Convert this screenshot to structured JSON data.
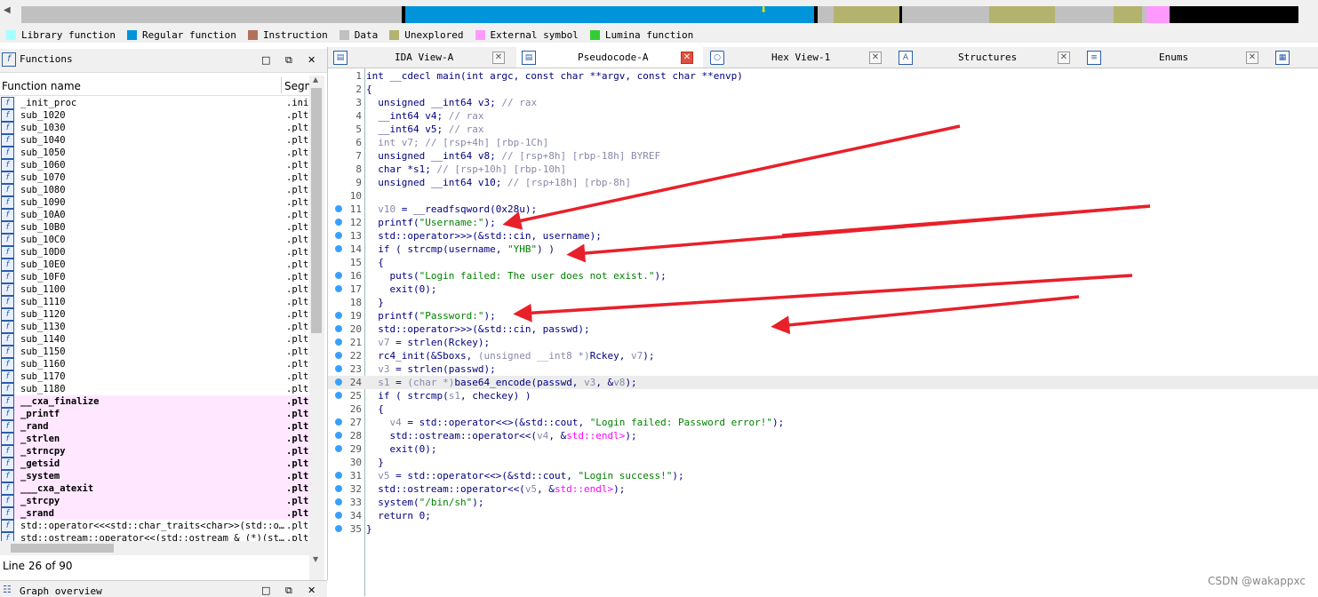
{
  "navbar": {
    "segments": [
      {
        "color": "#c0c0c0",
        "w": 428
      },
      {
        "color": "#000000",
        "w": 4
      },
      {
        "color": "#0094da",
        "w": 460
      },
      {
        "color": "#000000",
        "w": 4
      },
      {
        "color": "#c0c0c0",
        "w": 18
      },
      {
        "color": "#b3b36e",
        "w": 74
      },
      {
        "color": "#000000",
        "w": 3
      },
      {
        "color": "#c0c0c0",
        "w": 98
      },
      {
        "color": "#b3b36e",
        "w": 74
      },
      {
        "color": "#c0c0c0",
        "w": 66
      },
      {
        "color": "#b3b36e",
        "w": 32
      },
      {
        "color": "#c0c0c0",
        "w": 5
      },
      {
        "color": "#ff99ff",
        "w": 26
      },
      {
        "color": "#000000",
        "w": 145
      }
    ]
  },
  "legend": [
    {
      "label": "Library function",
      "color": "#a6ffff"
    },
    {
      "label": "Regular function",
      "color": "#0094da"
    },
    {
      "label": "Instruction",
      "color": "#b3705a"
    },
    {
      "label": "Data",
      "color": "#c0c0c0"
    },
    {
      "label": "Unexplored",
      "color": "#b3b36e"
    },
    {
      "label": "External symbol",
      "color": "#ff99ff"
    },
    {
      "label": "Lumina function",
      "color": "#33cc33"
    }
  ],
  "functions_panel": {
    "title": "Functions",
    "col_name": "Function name",
    "col_segment": "Segm",
    "status": "Line 26 of 90",
    "rows": [
      {
        "name": "_init_proc",
        "seg": ".init",
        "ext": false
      },
      {
        "name": "sub_1020",
        "seg": ".plt",
        "ext": false
      },
      {
        "name": "sub_1030",
        "seg": ".plt",
        "ext": false
      },
      {
        "name": "sub_1040",
        "seg": ".plt",
        "ext": false
      },
      {
        "name": "sub_1050",
        "seg": ".plt",
        "ext": false
      },
      {
        "name": "sub_1060",
        "seg": ".plt",
        "ext": false
      },
      {
        "name": "sub_1070",
        "seg": ".plt",
        "ext": false
      },
      {
        "name": "sub_1080",
        "seg": ".plt",
        "ext": false
      },
      {
        "name": "sub_1090",
        "seg": ".plt",
        "ext": false
      },
      {
        "name": "sub_10A0",
        "seg": ".plt",
        "ext": false
      },
      {
        "name": "sub_10B0",
        "seg": ".plt",
        "ext": false
      },
      {
        "name": "sub_10C0",
        "seg": ".plt",
        "ext": false
      },
      {
        "name": "sub_10D0",
        "seg": ".plt",
        "ext": false
      },
      {
        "name": "sub_10E0",
        "seg": ".plt",
        "ext": false
      },
      {
        "name": "sub_10F0",
        "seg": ".plt",
        "ext": false
      },
      {
        "name": "sub_1100",
        "seg": ".plt",
        "ext": false
      },
      {
        "name": "sub_1110",
        "seg": ".plt",
        "ext": false
      },
      {
        "name": "sub_1120",
        "seg": ".plt",
        "ext": false
      },
      {
        "name": "sub_1130",
        "seg": ".plt",
        "ext": false
      },
      {
        "name": "sub_1140",
        "seg": ".plt",
        "ext": false
      },
      {
        "name": "sub_1150",
        "seg": ".plt",
        "ext": false
      },
      {
        "name": "sub_1160",
        "seg": ".plt",
        "ext": false
      },
      {
        "name": "sub_1170",
        "seg": ".plt",
        "ext": false
      },
      {
        "name": "sub_1180",
        "seg": ".plt",
        "ext": false
      },
      {
        "name": "__cxa_finalize",
        "seg": ".plt",
        "ext": true
      },
      {
        "name": "_printf",
        "seg": ".plt",
        "ext": true
      },
      {
        "name": "_rand",
        "seg": ".plt",
        "ext": true
      },
      {
        "name": "_strlen",
        "seg": ".plt",
        "ext": true
      },
      {
        "name": "_strncpy",
        "seg": ".plt",
        "ext": true
      },
      {
        "name": "_getsid",
        "seg": ".plt",
        "ext": true
      },
      {
        "name": "_system",
        "seg": ".plt",
        "ext": true
      },
      {
        "name": "___cxa_atexit",
        "seg": ".plt",
        "ext": true
      },
      {
        "name": "_strcpy",
        "seg": ".plt",
        "ext": true
      },
      {
        "name": "_srand",
        "seg": ".plt",
        "ext": true
      },
      {
        "name": "std::operator<<<std::char_traits<char>>(std::o…",
        "seg": ".plt.",
        "ext": false
      },
      {
        "name": "std::ostream::operator<<(std::ostream & (*)(st…",
        "seg": ".plt.",
        "ext": false
      }
    ]
  },
  "graph_overview": {
    "title": "Graph overview"
  },
  "tabs": [
    {
      "label": "IDA View-A",
      "icon": "IDA",
      "active": false
    },
    {
      "label": "Pseudocode-A",
      "icon": "C",
      "active": true
    },
    {
      "label": "Hex View-1",
      "icon": "O",
      "active": false
    },
    {
      "label": "Structures",
      "icon": "A",
      "active": false
    },
    {
      "label": "Enums",
      "icon": "E",
      "active": false
    }
  ],
  "code_lines": [
    {
      "n": "1",
      "dot": false,
      "html": "int __cdecl main(int argc, const char **argv, const char **envp)"
    },
    {
      "n": "2",
      "dot": false,
      "html": "{"
    },
    {
      "n": "3",
      "dot": false,
      "html": "  unsigned __int64 v3; <span class=\"g\">// rax</span>"
    },
    {
      "n": "4",
      "dot": false,
      "html": "  __int64 v4; <span class=\"g\">// rax</span>"
    },
    {
      "n": "5",
      "dot": false,
      "html": "  __int64 v5; <span class=\"g\">// rax</span>"
    },
    {
      "n": "6",
      "dot": false,
      "html": "  <span class=\"g\">int v7; // [rsp+4h] [rbp-1Ch]</span>"
    },
    {
      "n": "7",
      "dot": false,
      "html": "  unsigned __int64 v8; <span class=\"g\">// [rsp+8h] [rbp-18h] BYREF</span>"
    },
    {
      "n": "8",
      "dot": false,
      "html": "  char *s1; <span class=\"g\">// [rsp+10h] [rbp-10h]</span>"
    },
    {
      "n": "9",
      "dot": false,
      "html": "  unsigned __int64 v10; <span class=\"g\">// [rsp+18h] [rbp-8h]</span>"
    },
    {
      "n": "10",
      "dot": false,
      "html": ""
    },
    {
      "n": "11",
      "dot": true,
      "html": "  <span class=\"g\">v10</span> = __readfsqword(0x28u);"
    },
    {
      "n": "12",
      "dot": true,
      "html": "  printf(<span class=\"s\">\"Username:\"</span>);"
    },
    {
      "n": "13",
      "dot": true,
      "html": "  std::operator>><char,std::char_traits<char>>(&std::cin, username);"
    },
    {
      "n": "14",
      "dot": true,
      "html": "  if ( strcmp(username, <span class=\"s\">\"YHB\"</span>) )"
    },
    {
      "n": "15",
      "dot": false,
      "html": "  {"
    },
    {
      "n": "16",
      "dot": true,
      "html": "    puts(<span class=\"s\">\"Login failed: The user does not exist.\"</span>);"
    },
    {
      "n": "17",
      "dot": true,
      "html": "    exit(0);"
    },
    {
      "n": "18",
      "dot": false,
      "html": "  }"
    },
    {
      "n": "19",
      "dot": true,
      "html": "  printf(<span class=\"s\">\"Password:\"</span>);"
    },
    {
      "n": "20",
      "dot": true,
      "html": "  std::operator>><char,std::char_traits<char>>(&std::cin, passwd);"
    },
    {
      "n": "21",
      "dot": true,
      "html": "  <span class=\"g\">v7</span> = strlen(Rckey);"
    },
    {
      "n": "22",
      "dot": true,
      "html": "  rc4_init(&Sboxs, <span class=\"g\">(unsigned __int8 *)</span>Rckey, <span class=\"g\">v7</span>);"
    },
    {
      "n": "23",
      "dot": true,
      "html": "  <span class=\"g\">v3</span> = strlen(passwd);"
    },
    {
      "n": "24",
      "dot": true,
      "html": "  <span class=\"g\">s1</span> = <span class=\"g\">(char *)</span>base64_encode(passwd, <span class=\"g\">v3</span>, &<span class=\"g\">v8</span>);"
    },
    {
      "n": "25",
      "dot": true,
      "html": "  if ( strcmp(<span class=\"g\">s1</span>, checkey) )"
    },
    {
      "n": "26",
      "dot": false,
      "html": "  {"
    },
    {
      "n": "27",
      "dot": true,
      "html": "    <span class=\"g\">v4</span> = std::operator<<<std::char_traits<char>>(&std::cout, <span class=\"s\">\"Login failed: Password error!\"</span>);"
    },
    {
      "n": "28",
      "dot": true,
      "html": "    std::ostream::operator<<(<span class=\"g\">v4</span>, &<span class=\"m\">std::endl<char,std::char_traits<char>></span>);"
    },
    {
      "n": "29",
      "dot": true,
      "html": "    exit(0);"
    },
    {
      "n": "30",
      "dot": false,
      "html": "  }"
    },
    {
      "n": "31",
      "dot": true,
      "html": "  <span class=\"g\">v5</span> = std::operator<<<std::char_traits<char>>(&std::cout, <span class=\"s\">\"Login success!\"</span>);"
    },
    {
      "n": "32",
      "dot": true,
      "html": "  std::ostream::operator<<(<span class=\"g\">v5</span>, &<span class=\"m\">std::endl<char,std::char_traits<char>></span>);"
    },
    {
      "n": "33",
      "dot": true,
      "html": "  system(<span class=\"s\">\"/bin/sh\"</span>);"
    },
    {
      "n": "34",
      "dot": true,
      "html": "  return 0;"
    },
    {
      "n": "35",
      "dot": true,
      "html": "}"
    }
  ],
  "highlighted_line": "24",
  "watermark": "CSDN @wakappxc"
}
